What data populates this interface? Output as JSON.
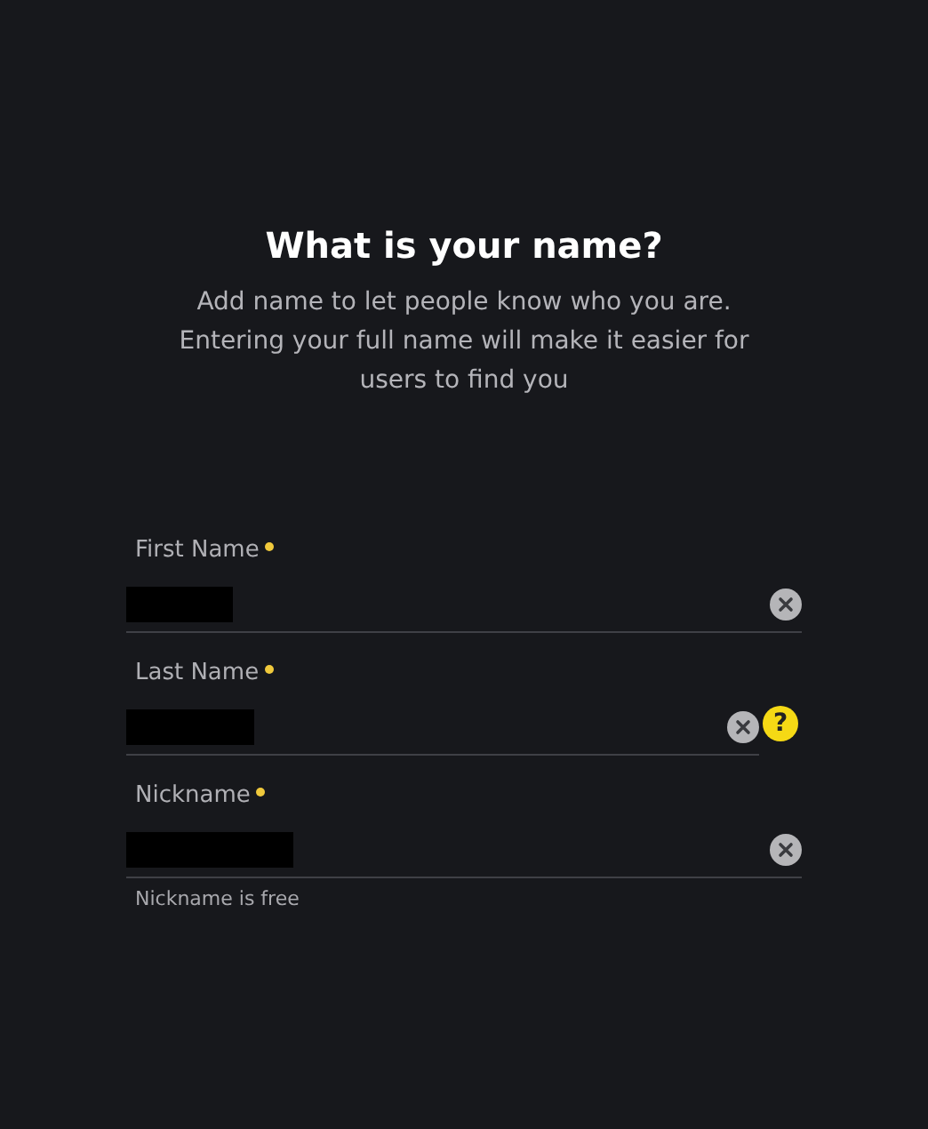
{
  "title": "What is your name?",
  "subtitle": "Add name to let people know who you are. Entering your full name will make it easier for users to find you",
  "fields": [
    {
      "label": "First Name",
      "required": true,
      "redacted": true,
      "clearable": true
    },
    {
      "label": "Last Name",
      "required": true,
      "redacted": true,
      "clearable": true,
      "help": "?"
    },
    {
      "label": "Nickname",
      "required": true,
      "redacted": true,
      "clearable": true,
      "hint": "Nickname is free"
    }
  ]
}
